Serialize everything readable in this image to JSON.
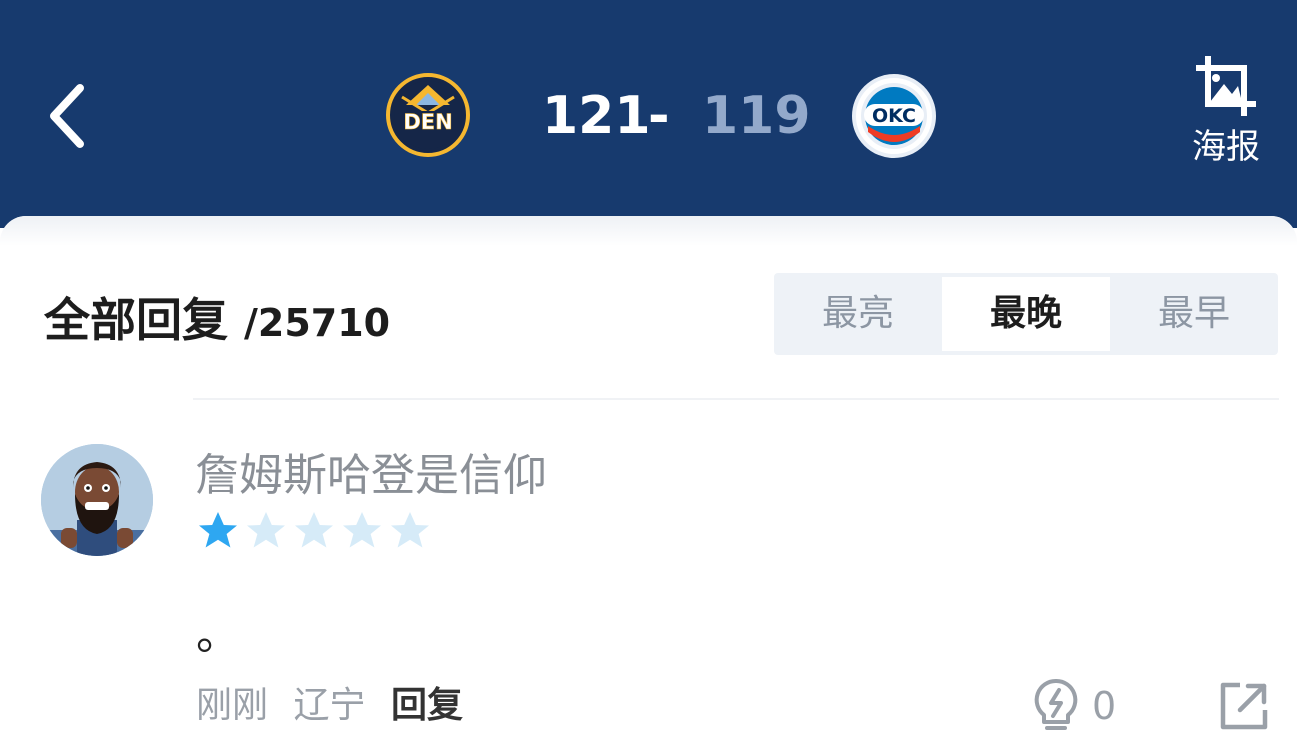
{
  "header": {
    "home_team": "DEN",
    "away_team": "OKC",
    "home_score": "121",
    "separator": "-",
    "away_score": "119",
    "poster_label": "海报",
    "back_icon": "chevron-left-icon",
    "poster_icon": "image-crop-icon"
  },
  "replies": {
    "title": "全部回复",
    "count": "/25710",
    "sort_tabs": [
      {
        "label": "最亮",
        "active": false
      },
      {
        "label": "最晚",
        "active": true
      },
      {
        "label": "最早",
        "active": false
      }
    ]
  },
  "comment": {
    "username": "詹姆斯哈登是信仰",
    "rating": 1,
    "rating_max": 5,
    "text": "。",
    "time": "刚刚",
    "location": "辽宁",
    "reply_label": "回复",
    "light_count": "0"
  },
  "colors": {
    "header_bg": "#173a6e",
    "star_active": "#2ea7f1",
    "star_inactive": "#d6ebf8"
  }
}
